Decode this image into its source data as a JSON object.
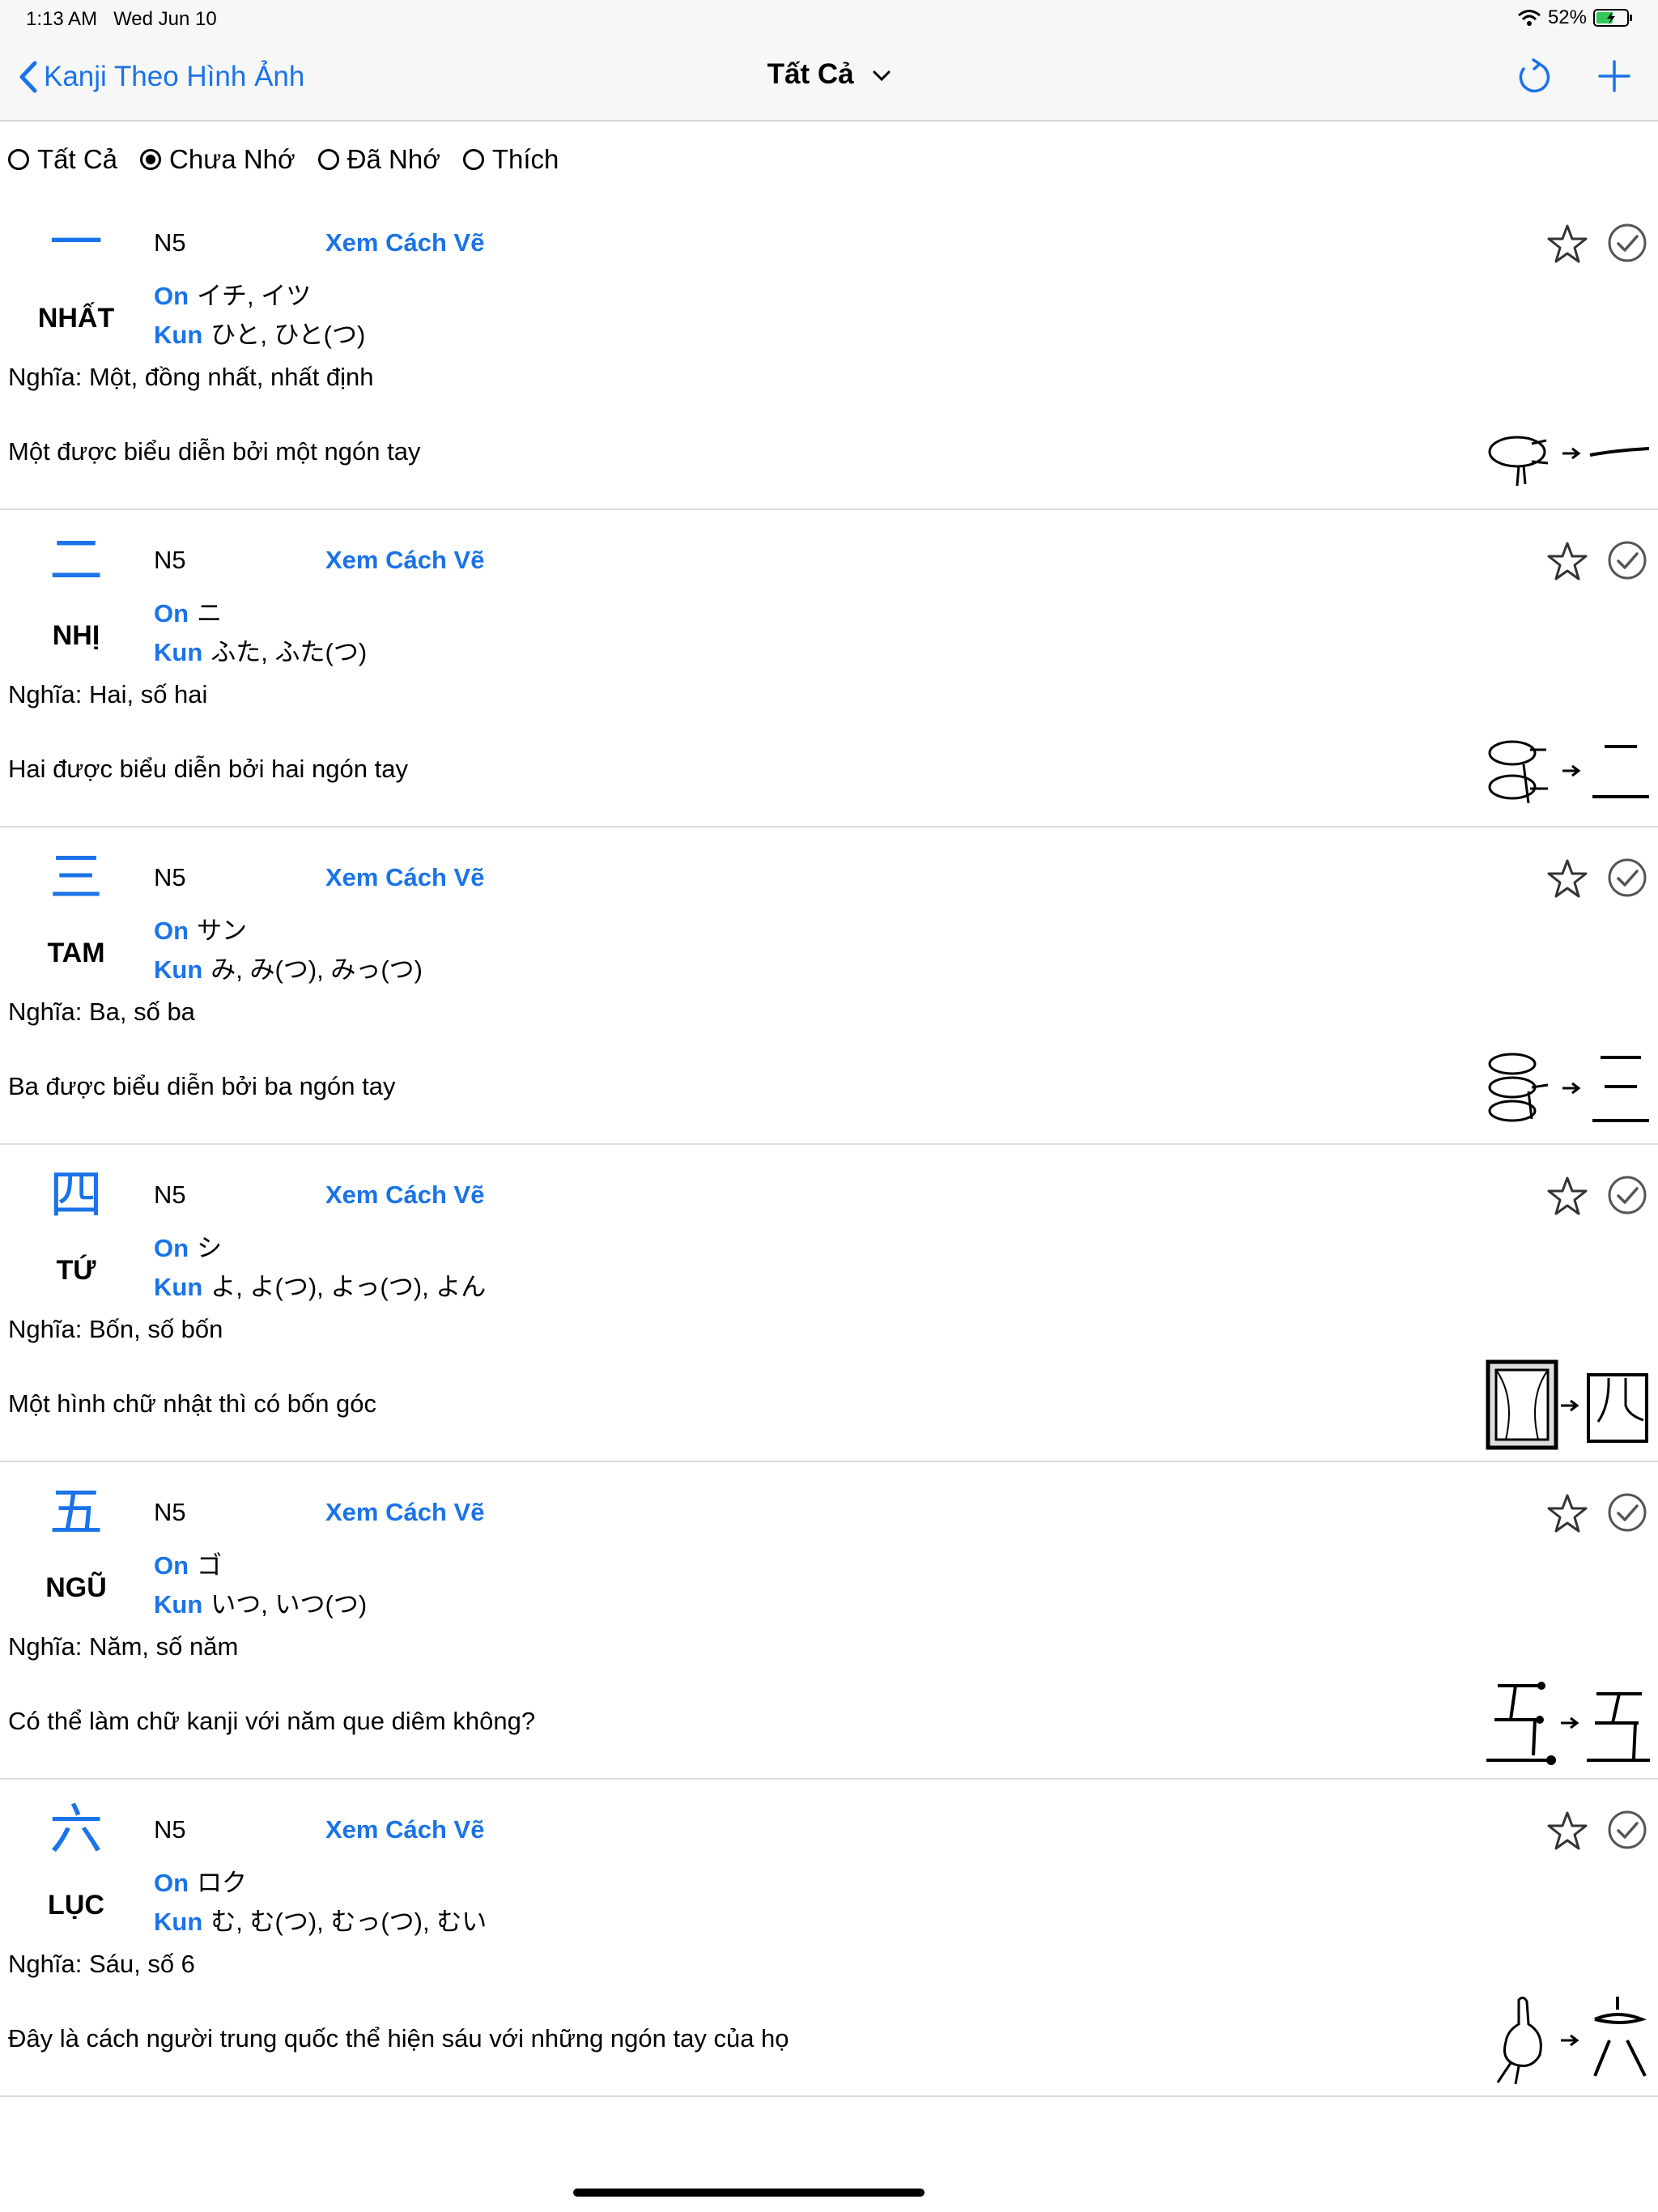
{
  "status_bar": {
    "time": "1:13 AM",
    "date": "Wed Jun 10",
    "battery": "52%"
  },
  "nav": {
    "back_label": "Kanji Theo Hình Ảnh",
    "title": "Tất Cả"
  },
  "filters": [
    {
      "label": "Tất Cả",
      "selected": false
    },
    {
      "label": "Chưa Nhớ",
      "selected": true
    },
    {
      "label": "Đã Nhớ",
      "selected": false
    },
    {
      "label": "Thích",
      "selected": false
    }
  ],
  "labels": {
    "on": "On",
    "kun": "Kun",
    "draw": "Xem Cách Vẽ"
  },
  "entries": [
    {
      "kanji": "一",
      "han_viet": "NHẤT",
      "level": "N5",
      "on": "イチ, イツ",
      "kun": "ひと, ひと(つ)",
      "meaning": "Nghĩa: Một, đồng nhất, nhất định",
      "story": "Một được biểu diễn bởi một ngón tay"
    },
    {
      "kanji": "二",
      "han_viet": "NHỊ",
      "level": "N5",
      "on": "ニ",
      "kun": "ふた, ふた(つ)",
      "meaning": "Nghĩa: Hai, số hai",
      "story": "Hai được biểu diễn bởi hai ngón tay"
    },
    {
      "kanji": "三",
      "han_viet": "TAM",
      "level": "N5",
      "on": "サン",
      "kun": "み, み(つ), みっ(つ)",
      "meaning": "Nghĩa: Ba, số ba",
      "story": "Ba được biểu diễn bởi ba ngón tay"
    },
    {
      "kanji": "四",
      "han_viet": "TỨ",
      "level": "N5",
      "on": "シ",
      "kun": "よ, よ(つ), よっ(つ), よん",
      "meaning": "Nghĩa: Bốn, số bốn",
      "story": "Một hình chữ nhật thì có bốn góc"
    },
    {
      "kanji": "五",
      "han_viet": "NGŨ",
      "level": "N5",
      "on": "ゴ",
      "kun": "いつ, いつ(つ)",
      "meaning": "Nghĩa: Năm, số năm",
      "story": "Có thể làm chữ kanji với năm que diêm không?"
    },
    {
      "kanji": "六",
      "han_viet": "LỤC",
      "level": "N5",
      "on": "ロク",
      "kun": "む, む(つ), むっ(つ), むい",
      "meaning": "Nghĩa: Sáu, số 6",
      "story": "Đây là cách người trung quốc thể hiện sáu với những ngón tay của họ"
    }
  ],
  "colors": {
    "accent": "#1a73e8"
  }
}
